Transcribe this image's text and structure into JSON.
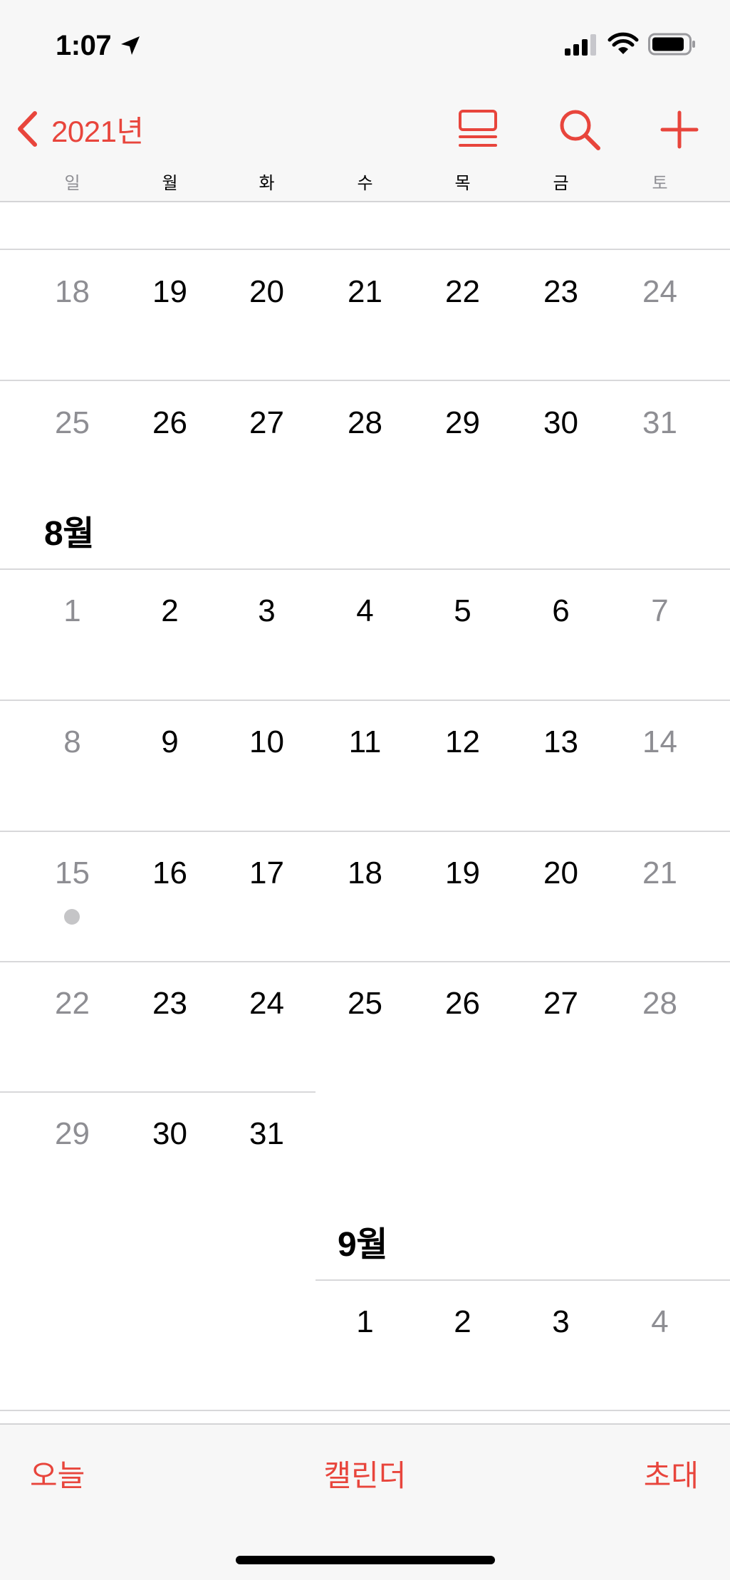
{
  "status_bar": {
    "time": "1:07",
    "icons": [
      "location-arrow-icon",
      "cellular-signal-icon",
      "wifi-icon",
      "battery-icon"
    ]
  },
  "nav": {
    "back_label": "2021년",
    "back_icon": "chevron-left-icon",
    "list_icon": "event-list-icon",
    "search_icon": "search-icon",
    "add_icon": "plus-icon",
    "accent_color": "#e8453c"
  },
  "weekdays": [
    "일",
    "월",
    "화",
    "수",
    "목",
    "금",
    "토"
  ],
  "months": {
    "july": {
      "weeks": [
        [
          "18",
          "19",
          "20",
          "21",
          "22",
          "23",
          "24"
        ],
        [
          "25",
          "26",
          "27",
          "28",
          "29",
          "30",
          "31"
        ]
      ]
    },
    "august": {
      "title": "8월",
      "weeks": [
        [
          "1",
          "2",
          "3",
          "4",
          "5",
          "6",
          "7"
        ],
        [
          "8",
          "9",
          "10",
          "11",
          "12",
          "13",
          "14"
        ],
        [
          "15",
          "16",
          "17",
          "18",
          "19",
          "20",
          "21"
        ],
        [
          "22",
          "23",
          "24",
          "25",
          "26",
          "27",
          "28"
        ],
        [
          "29",
          "30",
          "31"
        ]
      ],
      "event_dot_day": "15"
    },
    "september": {
      "title": "9월",
      "weeks": [
        [
          "1",
          "2",
          "3",
          "4"
        ]
      ]
    }
  },
  "toolbar": {
    "today": "오늘",
    "calendars": "캘린더",
    "inbox": "초대"
  },
  "colors": {
    "weekday_text": "#000000",
    "weekend_text": "#8e8e93",
    "event_dot": "#c5c5c7"
  }
}
